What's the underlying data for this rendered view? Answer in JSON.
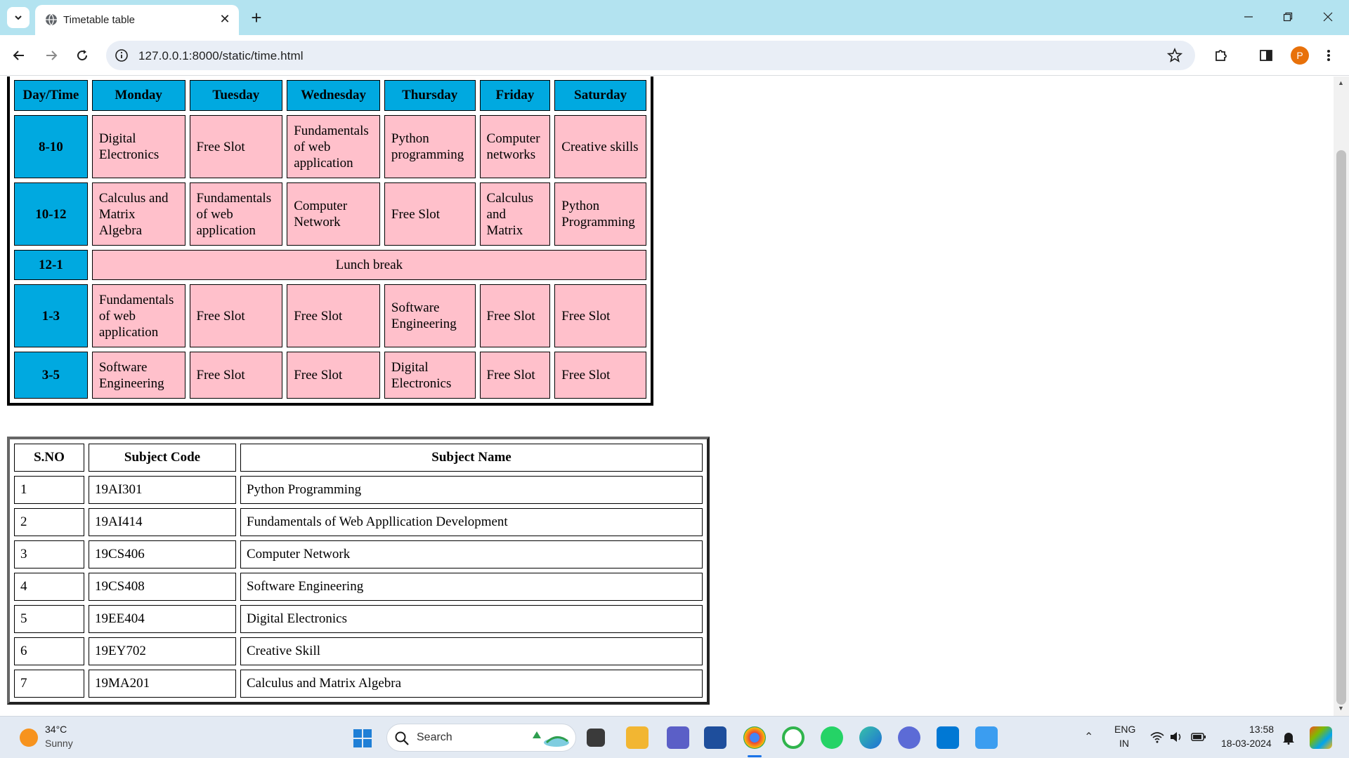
{
  "browser": {
    "tab_title": "Timetable table",
    "url": "127.0.0.1:8000/static/time.html",
    "profile_initial": "P",
    "accent": "#b3e3f0"
  },
  "timetable": {
    "header": [
      "Day/Time",
      "Monday",
      "Tuesday",
      "Wednesday",
      "Thursday",
      "Friday",
      "Saturday"
    ],
    "rows": [
      {
        "time": "8-10",
        "cells": [
          "Digital Electronics",
          "Free Slot",
          "Fundamentals of web application",
          "Python programming",
          "Computer networks",
          "Creative skills"
        ]
      },
      {
        "time": "10-12",
        "cells": [
          "Calculus and Matrix Algebra",
          "Fundamentals of web application",
          "Computer Network",
          "Free Slot",
          "Calculus and Matrix",
          "Python Programming"
        ]
      },
      {
        "time": "12-1",
        "lunch": "Lunch break"
      },
      {
        "time": "1-3",
        "cells": [
          "Fundamentals of web application",
          "Free Slot",
          "Free Slot",
          "Software Engineering",
          "Free Slot",
          "Free Slot"
        ]
      },
      {
        "time": "3-5",
        "cells": [
          "Software Engineering",
          "Free Slot",
          "Free Slot",
          "Digital Electronics",
          "Free Slot",
          "Free Slot"
        ]
      }
    ],
    "header_color": "#00a9e0",
    "cell_color": "#ffc0cb"
  },
  "subjects": {
    "header": [
      "S.NO",
      "Subject Code",
      "Subject Name"
    ],
    "rows": [
      [
        "1",
        "19AI301",
        "Python Programming"
      ],
      [
        "2",
        "19AI414",
        "Fundamentals of Web Appllication Development"
      ],
      [
        "3",
        "19CS406",
        "Computer Network"
      ],
      [
        "4",
        "19CS408",
        "Software Engineering"
      ],
      [
        "5",
        "19EE404",
        "Digital Electronics"
      ],
      [
        "6",
        "19EY702",
        "Creative Skill"
      ],
      [
        "7",
        "19MA201",
        "Calculus and Matrix Algebra"
      ]
    ]
  },
  "taskbar": {
    "weather_temp": "34°C",
    "weather_desc": "Sunny",
    "search_label": "Search",
    "lang_line1": "ENG",
    "lang_line2": "IN",
    "time": "13:58",
    "date": "18-03-2024"
  }
}
